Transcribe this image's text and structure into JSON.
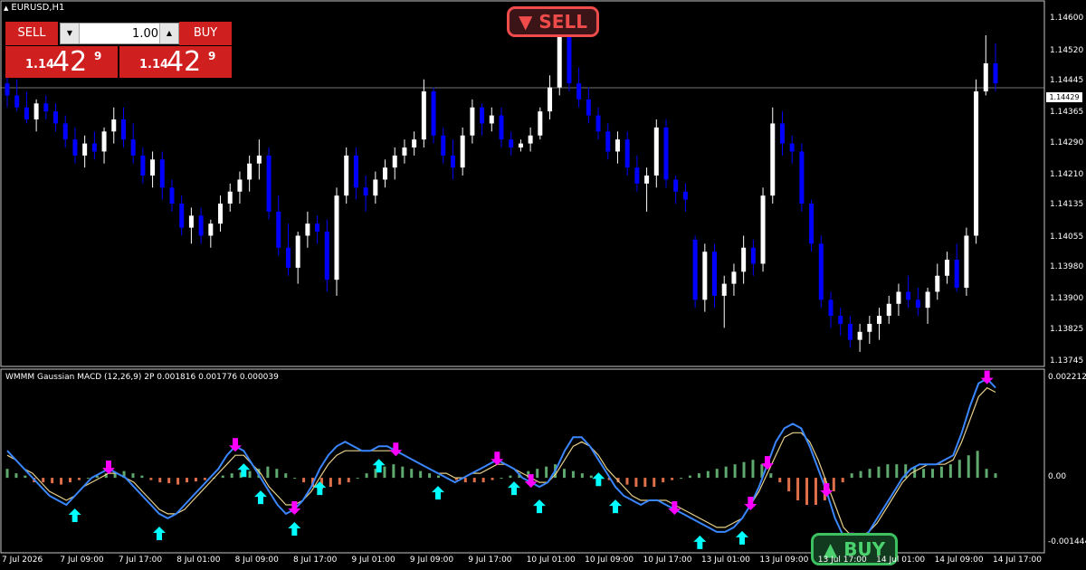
{
  "symbol": "EURUSD,H1",
  "indicator_title": "WMMM Gaussian MACD (12,26,9) 2P 0.001816 0.001776 0.000039",
  "trade_panel": {
    "sell_label": "SELL",
    "buy_label": "BUY",
    "lot": "1.00",
    "sell_price_small": "1.14",
    "sell_price_big": "42",
    "sell_price_sup": "9",
    "buy_price_small": "1.14",
    "buy_price_big": "42",
    "buy_price_sup": "9"
  },
  "signals": {
    "sell": "▼ SELL",
    "buy": "▲ BUY"
  },
  "current_price": "1.14429",
  "price_axis": [
    "1.14600",
    "1.14520",
    "1.14445",
    "1.14365",
    "1.14290",
    "1.14210",
    "1.14135",
    "1.14055",
    "1.13980",
    "1.13900",
    "1.13825",
    "1.13745"
  ],
  "indicator_axis": [
    "0.002212",
    "0.00",
    "-0.001444"
  ],
  "time_axis": [
    "7 Jul 2026",
    "7 Jul 09:00",
    "7 Jul 17:00",
    "8 Jul 01:00",
    "8 Jul 09:00",
    "8 Jul 17:00",
    "9 Jul 01:00",
    "9 Jul 09:00",
    "9 Jul 17:00",
    "10 Jul 01:00",
    "10 Jul 09:00",
    "10 Jul 17:00",
    "13 Jul 01:00",
    "13 Jul 09:00",
    "13 Jul 17:00",
    "14 Jul 01:00",
    "14 Jul 09:00",
    "14 Jul 17:00"
  ],
  "colors": {
    "bull": "#ffffff",
    "bear": "#0000ff",
    "sell_arrow": "#ff00ff",
    "buy_arrow": "#00ffff",
    "hist_pos": "#5fa86e",
    "hist_neg": "#e0704a",
    "macd": "#3a86ff",
    "signal": "#e8d08a",
    "panel_red": "#cf1f1f"
  },
  "chart_data": {
    "type": "candlestick",
    "series": [
      {
        "name": "EURUSD,H1",
        "ohlc": [
          [
            1.1444,
            1.1447,
            1.1438,
            1.1441
          ],
          [
            1.1441,
            1.1445,
            1.1437,
            1.1438
          ],
          [
            1.1438,
            1.1442,
            1.1434,
            1.1435
          ],
          [
            1.1435,
            1.144,
            1.1432,
            1.1439
          ],
          [
            1.1439,
            1.1441,
            1.1435,
            1.1437
          ],
          [
            1.1437,
            1.1439,
            1.1432,
            1.1434
          ],
          [
            1.1434,
            1.1436,
            1.1428,
            1.143
          ],
          [
            1.143,
            1.1433,
            1.1424,
            1.1426
          ],
          [
            1.1426,
            1.1431,
            1.1423,
            1.1429
          ],
          [
            1.1429,
            1.1432,
            1.1425,
            1.1427
          ],
          [
            1.1427,
            1.1433,
            1.1424,
            1.1432
          ],
          [
            1.1432,
            1.1438,
            1.1429,
            1.1435
          ],
          [
            1.1435,
            1.1438,
            1.1428,
            1.143
          ],
          [
            1.143,
            1.1434,
            1.1424,
            1.1426
          ],
          [
            1.1426,
            1.1428,
            1.1419,
            1.1421
          ],
          [
            1.1421,
            1.1427,
            1.1418,
            1.1425
          ],
          [
            1.1425,
            1.1427,
            1.1415,
            1.1418
          ],
          [
            1.1418,
            1.142,
            1.1412,
            1.1414
          ],
          [
            1.1414,
            1.1416,
            1.1406,
            1.1408
          ],
          [
            1.1408,
            1.1413,
            1.1404,
            1.1411
          ],
          [
            1.1411,
            1.1413,
            1.1404,
            1.1406
          ],
          [
            1.1406,
            1.141,
            1.1403,
            1.1409
          ],
          [
            1.1409,
            1.1416,
            1.1407,
            1.1414
          ],
          [
            1.1414,
            1.1419,
            1.1412,
            1.1417
          ],
          [
            1.1417,
            1.1422,
            1.1414,
            1.142
          ],
          [
            1.142,
            1.1426,
            1.1417,
            1.1424
          ],
          [
            1.1424,
            1.143,
            1.142,
            1.1426
          ],
          [
            1.1426,
            1.1428,
            1.141,
            1.1412
          ],
          [
            1.1412,
            1.1416,
            1.1401,
            1.1403
          ],
          [
            1.1403,
            1.1409,
            1.1396,
            1.1398
          ],
          [
            1.1398,
            1.1407,
            1.1394,
            1.1406
          ],
          [
            1.1406,
            1.1412,
            1.1403,
            1.1409
          ],
          [
            1.1409,
            1.1411,
            1.1404,
            1.1407
          ],
          [
            1.1407,
            1.141,
            1.1392,
            1.1395
          ],
          [
            1.1395,
            1.1418,
            1.1391,
            1.1416
          ],
          [
            1.1416,
            1.1428,
            1.1414,
            1.1426
          ],
          [
            1.1426,
            1.1428,
            1.1415,
            1.1418
          ],
          [
            1.1418,
            1.1421,
            1.1412,
            1.1416
          ],
          [
            1.1416,
            1.1422,
            1.1414,
            1.142
          ],
          [
            1.142,
            1.1425,
            1.1418,
            1.1423
          ],
          [
            1.1423,
            1.1428,
            1.142,
            1.1426
          ],
          [
            1.1426,
            1.143,
            1.1424,
            1.1428
          ],
          [
            1.1428,
            1.1432,
            1.1426,
            1.143
          ],
          [
            1.143,
            1.1445,
            1.1428,
            1.1442
          ],
          [
            1.1442,
            1.1443,
            1.1429,
            1.1431
          ],
          [
            1.1431,
            1.1433,
            1.1424,
            1.1426
          ],
          [
            1.1426,
            1.143,
            1.142,
            1.1423
          ],
          [
            1.1423,
            1.1433,
            1.1421,
            1.1431
          ],
          [
            1.1431,
            1.144,
            1.1429,
            1.1438
          ],
          [
            1.1438,
            1.1439,
            1.1431,
            1.1434
          ],
          [
            1.1434,
            1.1438,
            1.1432,
            1.1436
          ],
          [
            1.1436,
            1.1438,
            1.1428,
            1.143
          ],
          [
            1.143,
            1.1432,
            1.1426,
            1.1428
          ],
          [
            1.1428,
            1.143,
            1.1427,
            1.1429
          ],
          [
            1.1429,
            1.1433,
            1.1427,
            1.1431
          ],
          [
            1.1431,
            1.1438,
            1.143,
            1.1437
          ],
          [
            1.1437,
            1.1446,
            1.1435,
            1.1443
          ],
          [
            1.1443,
            1.1452,
            1.1441,
            1.1458
          ],
          [
            1.1458,
            1.146,
            1.1442,
            1.1444
          ],
          [
            1.1444,
            1.1448,
            1.1438,
            1.144
          ],
          [
            1.144,
            1.1443,
            1.1434,
            1.1436
          ],
          [
            1.1436,
            1.1438,
            1.143,
            1.1432
          ],
          [
            1.1432,
            1.1434,
            1.1425,
            1.1427
          ],
          [
            1.1427,
            1.1432,
            1.1424,
            1.143
          ],
          [
            1.143,
            1.1432,
            1.1421,
            1.1423
          ],
          [
            1.1423,
            1.1426,
            1.1417,
            1.1419
          ],
          [
            1.1419,
            1.1423,
            1.1412,
            1.1421
          ],
          [
            1.1421,
            1.1435,
            1.1418,
            1.1433
          ],
          [
            1.1433,
            1.1435,
            1.1418,
            1.142
          ],
          [
            1.142,
            1.1421,
            1.1414,
            1.1417
          ],
          [
            1.1417,
            1.1419,
            1.1412,
            1.1415
          ],
          [
            1.1405,
            1.1406,
            1.1388,
            1.139
          ],
          [
            1.139,
            1.1404,
            1.1387,
            1.1402
          ],
          [
            1.1402,
            1.1404,
            1.1388,
            1.1391
          ],
          [
            1.1391,
            1.1396,
            1.1383,
            1.1394
          ],
          [
            1.1394,
            1.1399,
            1.1391,
            1.1397
          ],
          [
            1.1397,
            1.1406,
            1.1394,
            1.1403
          ],
          [
            1.1403,
            1.1405,
            1.1396,
            1.1399
          ],
          [
            1.1399,
            1.1418,
            1.1397,
            1.1416
          ],
          [
            1.1416,
            1.1438,
            1.1414,
            1.1434
          ],
          [
            1.1434,
            1.1437,
            1.1426,
            1.1429
          ],
          [
            1.1429,
            1.1431,
            1.1424,
            1.1427
          ],
          [
            1.1427,
            1.1429,
            1.1412,
            1.1414
          ],
          [
            1.1414,
            1.1415,
            1.1402,
            1.1404
          ],
          [
            1.1404,
            1.1406,
            1.1388,
            1.139
          ],
          [
            1.139,
            1.1392,
            1.1383,
            1.1386
          ],
          [
            1.1386,
            1.1388,
            1.1381,
            1.1384
          ],
          [
            1.1384,
            1.1386,
            1.1378,
            1.138
          ],
          [
            1.138,
            1.1384,
            1.1377,
            1.1382
          ],
          [
            1.1382,
            1.1386,
            1.1379,
            1.1384
          ],
          [
            1.1384,
            1.1388,
            1.138,
            1.1386
          ],
          [
            1.1386,
            1.1391,
            1.1384,
            1.1389
          ],
          [
            1.1389,
            1.1394,
            1.1386,
            1.1392
          ],
          [
            1.1392,
            1.1396,
            1.1388,
            1.139
          ],
          [
            1.139,
            1.1393,
            1.1386,
            1.1388
          ],
          [
            1.1388,
            1.1393,
            1.1384,
            1.1392
          ],
          [
            1.1392,
            1.1399,
            1.139,
            1.1396
          ],
          [
            1.1396,
            1.1402,
            1.1394,
            1.14
          ],
          [
            1.14,
            1.1404,
            1.1392,
            1.1393
          ],
          [
            1.1393,
            1.1408,
            1.1391,
            1.1406
          ],
          [
            1.1406,
            1.1445,
            1.1404,
            1.1442
          ],
          [
            1.1442,
            1.1456,
            1.1441,
            1.1449
          ],
          [
            1.1449,
            1.1454,
            1.1442,
            1.1444
          ]
        ]
      }
    ],
    "ylim": [
      1.13745,
      1.1463
    ],
    "indicator": {
      "name": "WMMM Gaussian MACD (12,26,9) 2P",
      "ylim": [
        -0.001444,
        0.002212
      ],
      "histogram": [
        0.0002,
        0.0001,
        5e-05,
        -0.0001,
        -0.0001,
        -0.00012,
        -0.00015,
        -0.0001,
        -5e-05,
        0,
        5e-05,
        0.0001,
        0.00012,
        0.00015,
        0.0001,
        5e-05,
        -5e-05,
        -0.0001,
        -0.00012,
        -0.00015,
        -0.0001,
        -8e-05,
        -5e-05,
        0,
        5e-05,
        0.0001,
        0.00012,
        0.00015,
        0.0002,
        0.00025,
        0.0002,
        0.0001,
        0,
        -0.0001,
        -0.0002,
        -0.00025,
        -0.0002,
        -0.00015,
        -0.0001,
        0,
        0.0001,
        0.0002,
        0.00025,
        0.0003,
        0.00025,
        0.0002,
        0.00015,
        0.0001,
        5e-05,
        0,
        -5e-05,
        -0.0001,
        -0.0001,
        -0.0001,
        -5e-05,
        0,
        5e-05,
        0.0001,
        0.00015,
        0.0002,
        0.00025,
        0.0003,
        0.0002,
        0.00015,
        0.0001,
        5e-05,
        0,
        -5e-05,
        -0.0001,
        -0.00015,
        -0.0002,
        -0.0002,
        -0.0002,
        -0.0001,
        -5e-05,
        0,
        5e-05,
        0.0001,
        0.00015,
        0.0002,
        0.00025,
        0.0003,
        0.00035,
        0.0004,
        0.0003,
        0.0001,
        -0.0001,
        -0.0003,
        -0.0005,
        -0.0006,
        -0.0006,
        -0.0005,
        -0.0003,
        -0.0001,
        0.0001,
        0.00015,
        0.0002,
        0.00025,
        0.0003,
        0.0003,
        0.0003,
        0.00025,
        0.0002,
        0.0002,
        0.00025,
        0.0003,
        0.0004,
        0.0005,
        0.0006,
        0.0002,
        0.0001
      ],
      "macd": [
        0.0006,
        0.0004,
        0.0002,
        0.0,
        -0.0002,
        -0.0004,
        -0.0005,
        -0.0006,
        -0.0004,
        -0.0002,
        0.0,
        0.0001,
        0.0002,
        0.0001,
        0.0,
        -0.0002,
        -0.0004,
        -0.0006,
        -0.0008,
        -0.0009,
        -0.0008,
        -0.0006,
        -0.0004,
        -0.0002,
        0.0,
        0.0002,
        0.0005,
        0.0007,
        0.0006,
        0.0003,
        0.0,
        -0.0003,
        -0.0006,
        -0.0008,
        -0.0007,
        -0.0005,
        -0.0002,
        0.0002,
        0.0005,
        0.0007,
        0.0008,
        0.0007,
        0.0006,
        0.0006,
        0.0007,
        0.0007,
        0.0006,
        0.0005,
        0.0004,
        0.0003,
        0.0002,
        0.0001,
        0.0,
        -0.0001,
        0.0,
        0.0001,
        0.0002,
        0.0003,
        0.0004,
        0.0003,
        0.0002,
        0.0,
        -0.0001,
        -0.0002,
        -0.0001,
        0.0002,
        0.0006,
        0.0009,
        0.0009,
        0.0007,
        0.0004,
        0.0001,
        -0.0002,
        -0.0004,
        -0.0005,
        -0.0006,
        -0.0005,
        -0.0005,
        -0.0006,
        -0.0007,
        -0.0008,
        -0.0009,
        -0.001,
        -0.0011,
        -0.0012,
        -0.0012,
        -0.0011,
        -0.0009,
        -0.0006,
        -0.0002,
        0.0003,
        0.0008,
        0.0011,
        0.0012,
        0.0011,
        0.0007,
        0.0002,
        -0.0003,
        -0.0009,
        -0.0013,
        -0.0014,
        -0.0014,
        -0.0012,
        -0.0009,
        -0.0006,
        -0.0003,
        0.0,
        0.0002,
        0.0003,
        0.0003,
        0.0003,
        0.0004,
        0.0005,
        0.001,
        0.0016,
        0.0021,
        0.0022,
        0.002
      ],
      "signal_line": [
        0.0005,
        0.0004,
        0.0002,
        0.0001,
        -0.0001,
        -0.0003,
        -0.0004,
        -0.0005,
        -0.0004,
        -0.0002,
        -0.0001,
        0.0,
        0.0001,
        0.0001,
        0.0,
        -0.0001,
        -0.0003,
        -0.0005,
        -0.0007,
        -0.0008,
        -0.0008,
        -0.0007,
        -0.0005,
        -0.0003,
        -0.0001,
        0.0001,
        0.0003,
        0.0005,
        0.0005,
        0.0003,
        0.0001,
        -0.0002,
        -0.0004,
        -0.0006,
        -0.0006,
        -0.0005,
        -0.0003,
        0.0,
        0.0003,
        0.0005,
        0.0006,
        0.0006,
        0.0006,
        0.0006,
        0.0006,
        0.0006,
        0.0006,
        0.0005,
        0.0004,
        0.0003,
        0.0002,
        0.0001,
        0.0001,
        0.0,
        0.0,
        0.0001,
        0.0001,
        0.0002,
        0.0003,
        0.0003,
        0.0002,
        0.0001,
        0.0,
        -0.0001,
        -0.0001,
        0.0001,
        0.0004,
        0.0007,
        0.0008,
        0.0007,
        0.0005,
        0.0002,
        0.0,
        -0.0002,
        -0.0004,
        -0.0005,
        -0.0005,
        -0.0005,
        -0.0005,
        -0.0006,
        -0.0007,
        -0.0008,
        -0.0009,
        -0.001,
        -0.0011,
        -0.0011,
        -0.001,
        -0.0009,
        -0.0006,
        -0.0003,
        0.0001,
        0.0005,
        0.0009,
        0.001,
        0.001,
        0.0008,
        0.0004,
        -0.0001,
        -0.0006,
        -0.0011,
        -0.0013,
        -0.0013,
        -0.0012,
        -0.001,
        -0.0007,
        -0.0004,
        -0.0001,
        0.0001,
        0.0002,
        0.0003,
        0.0003,
        0.0003,
        0.0004,
        0.0008,
        0.0013,
        0.0018,
        0.002,
        0.0019
      ],
      "sell_arrows_at_bar": [
        19,
        42,
        53,
        71,
        89,
        95,
        121,
        139,
        135,
        149,
        154,
        178
      ],
      "buy_arrows_at_bar": [
        13,
        28,
        43,
        46,
        52,
        57,
        68,
        78,
        92,
        97,
        108,
        110,
        126,
        134
      ],
      "note_units": "bar index"
    }
  }
}
